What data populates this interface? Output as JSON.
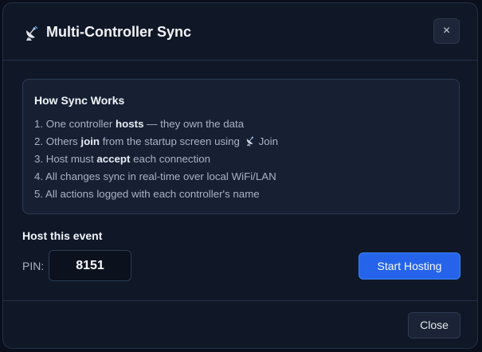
{
  "dialog": {
    "title": "Multi-Controller Sync",
    "title_icon": "satellite-dish-icon",
    "close_x": "×"
  },
  "info": {
    "title": "How Sync Works",
    "steps": [
      {
        "pre": "1. One controller ",
        "bold": "hosts",
        "post": " — they own the data"
      },
      {
        "pre": "2. Others ",
        "bold": "join",
        "post": " from the startup screen using ",
        "icon": "satellite-dish-icon",
        "tail": "Join"
      },
      {
        "pre": "3. Host must ",
        "bold": "accept",
        "post": " each connection"
      },
      {
        "pre": "4. All changes sync in real-time over local WiFi/LAN"
      },
      {
        "pre": "5. All actions logged with each controller's name"
      }
    ]
  },
  "host": {
    "heading": "Host this event",
    "pin_label": "PIN:",
    "pin_value": "8151",
    "start_button": "Start Hosting"
  },
  "footer": {
    "close_button": "Close"
  },
  "colors": {
    "accent": "#2563eb",
    "background": "#101828",
    "panel": "#172033"
  }
}
